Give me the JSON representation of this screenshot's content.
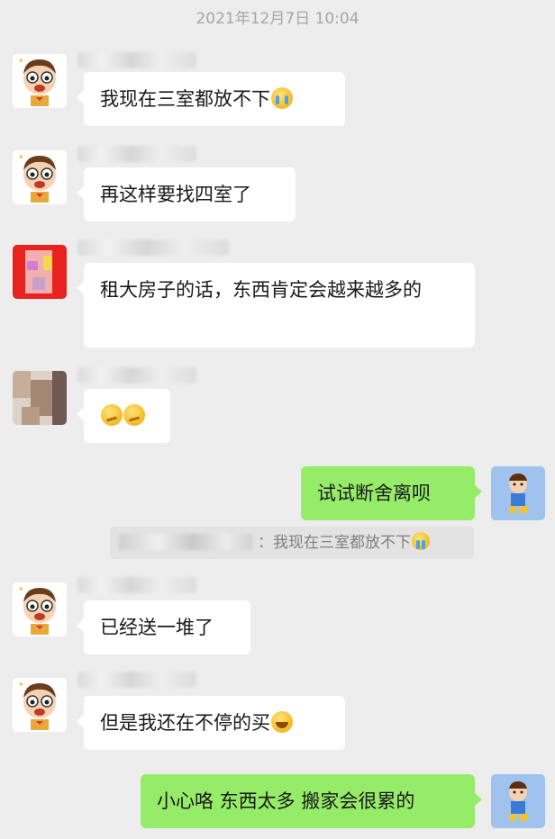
{
  "timestamp": "2021年12月7日 10:04",
  "messages": [
    {
      "text": "我现在三室都放不下",
      "emoji": "crying-face"
    },
    {
      "text": "再这样要找四室了"
    },
    {
      "text": "租大房子的话，东西肯定会越来越多的"
    },
    {
      "emoji": "thinking-face-x2"
    },
    {
      "text": "试试断舍离呗"
    },
    {
      "quote_sep": "：",
      "quote_text": "我现在三室都放不下",
      "quote_emoji": "crying-face"
    },
    {
      "text": "已经送一堆了"
    },
    {
      "text": "但是我还在不停的买",
      "emoji": "laughing-tears-face"
    },
    {
      "text": "小心咯 东西太多 搬家会很累的"
    }
  ]
}
